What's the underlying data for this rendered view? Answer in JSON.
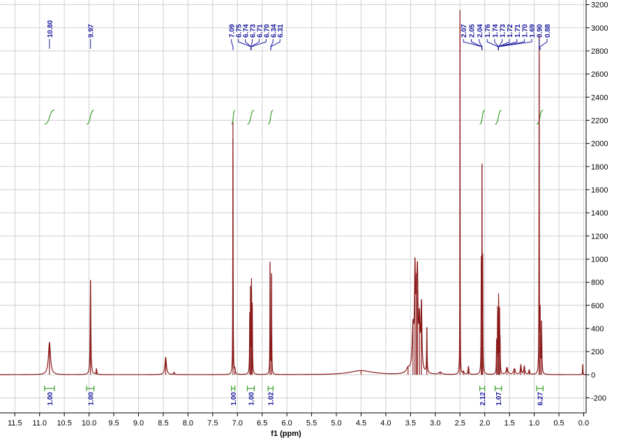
{
  "chart_data": {
    "type": "line",
    "xlabel": "f1 (ppm)",
    "ylabel": "",
    "xlim": [
      11.8,
      -0.05
    ],
    "ylim": [
      -330,
      3240
    ],
    "x_reversed": true,
    "grid": true,
    "x_ticks": [
      11.5,
      11.0,
      10.5,
      10.0,
      9.5,
      9.0,
      8.5,
      8.0,
      7.5,
      7.0,
      6.5,
      6.0,
      5.5,
      5.0,
      4.5,
      4.0,
      3.5,
      3.0,
      2.5,
      2.0,
      1.5,
      1.0,
      0.5,
      0.0
    ],
    "x_tick_labels": [
      "11.5",
      "11.0",
      "10.5",
      "10.0",
      "9.5",
      "9.0",
      "8.5",
      "8.0",
      "7.5",
      "7.0",
      "6.5",
      "6.0",
      "5.5",
      "5.0",
      "4.5",
      "4.0",
      "3.5",
      "3.0",
      "2.5",
      "2.0",
      "1.5",
      "1.0",
      "0.5",
      "0.0"
    ],
    "y_ticks": [
      3200,
      3000,
      2800,
      2600,
      2400,
      2200,
      2000,
      1800,
      1600,
      1400,
      1200,
      1000,
      800,
      600,
      400,
      200,
      0,
      -200
    ],
    "y_tick_labels": [
      "3200",
      "3000",
      "2800",
      "2600",
      "2400",
      "2200",
      "2000",
      "1800",
      "1600",
      "1400",
      "1200",
      "1000",
      "800",
      "600",
      "400",
      "200",
      "0",
      "-200"
    ],
    "colors": {
      "spectrum": "#8b1a1a",
      "peak_label": "#1a1aa0",
      "integral": "#3aa02a",
      "integral_label": "#1a1aa0",
      "grid": "#cfcfcf"
    },
    "peaks": [
      {
        "ppm": 10.8,
        "height": 280,
        "width": 0.025
      },
      {
        "ppm": 9.97,
        "height": 820,
        "width": 0.008
      },
      {
        "ppm": 9.85,
        "height": 50,
        "width": 0.008
      },
      {
        "ppm": 8.45,
        "height": 150,
        "width": 0.018
      },
      {
        "ppm": 8.28,
        "height": 20,
        "width": 0.01
      },
      {
        "ppm": 7.09,
        "height": 2180,
        "width": 0.004
      },
      {
        "ppm": 7.05,
        "height": 40,
        "width": 0.008
      },
      {
        "ppm": 6.75,
        "height": 480,
        "width": 0.005
      },
      {
        "ppm": 6.735,
        "height": 680,
        "width": 0.004
      },
      {
        "ppm": 6.715,
        "height": 740,
        "width": 0.004
      },
      {
        "ppm": 6.7,
        "height": 560,
        "width": 0.005
      },
      {
        "ppm": 6.34,
        "height": 960,
        "width": 0.004
      },
      {
        "ppm": 6.31,
        "height": 860,
        "width": 0.004
      },
      {
        "ppm": 4.5,
        "height": 35,
        "width": 0.28
      },
      {
        "ppm": 3.55,
        "height": 40,
        "width": 0.04
      },
      {
        "ppm": 3.45,
        "height": 360,
        "width": 0.02
      },
      {
        "ppm": 3.41,
        "height": 780,
        "width": 0.012
      },
      {
        "ppm": 3.38,
        "height": 520,
        "width": 0.015
      },
      {
        "ppm": 3.36,
        "height": 660,
        "width": 0.012
      },
      {
        "ppm": 3.32,
        "height": 420,
        "width": 0.015
      },
      {
        "ppm": 3.28,
        "height": 560,
        "width": 0.012
      },
      {
        "ppm": 3.17,
        "height": 390,
        "width": 0.006
      },
      {
        "ppm": 2.9,
        "height": 20,
        "width": 0.03
      },
      {
        "ppm": 2.5,
        "height": 3150,
        "width": 0.003
      },
      {
        "ppm": 2.43,
        "height": 25,
        "width": 0.012
      },
      {
        "ppm": 2.33,
        "height": 70,
        "width": 0.01
      },
      {
        "ppm": 2.07,
        "height": 920,
        "width": 0.004
      },
      {
        "ppm": 2.055,
        "height": 1700,
        "width": 0.0035
      },
      {
        "ppm": 2.04,
        "height": 940,
        "width": 0.004
      },
      {
        "ppm": 1.76,
        "height": 280,
        "width": 0.005
      },
      {
        "ppm": 1.74,
        "height": 540,
        "width": 0.004
      },
      {
        "ppm": 1.72,
        "height": 650,
        "width": 0.004
      },
      {
        "ppm": 1.7,
        "height": 500,
        "width": 0.004
      },
      {
        "ppm": 1.69,
        "height": 250,
        "width": 0.005
      },
      {
        "ppm": 1.55,
        "height": 60,
        "width": 0.02
      },
      {
        "ppm": 1.4,
        "height": 50,
        "width": 0.02
      },
      {
        "ppm": 1.27,
        "height": 80,
        "width": 0.012
      },
      {
        "ppm": 1.2,
        "height": 70,
        "width": 0.012
      },
      {
        "ppm": 1.1,
        "height": 40,
        "width": 0.012
      },
      {
        "ppm": 0.9,
        "height": 2900,
        "width": 0.0035
      },
      {
        "ppm": 0.88,
        "height": 500,
        "width": 0.005
      },
      {
        "ppm": 0.85,
        "height": 440,
        "width": 0.006
      },
      {
        "ppm": 0.02,
        "height": 90,
        "width": 0.004
      }
    ],
    "peak_label_groups": [
      {
        "labels": [
          "10.80"
        ],
        "positions": [
          10.8
        ],
        "target": 10.8
      },
      {
        "labels": [
          "9.97"
        ],
        "positions": [
          9.97
        ],
        "target": 9.97
      },
      {
        "labels": [
          "7.09",
          "6.75",
          "6.74",
          "6.73",
          "6.71",
          "6.70",
          "6.34",
          "6.31"
        ],
        "positions": [
          7.12,
          6.98,
          6.84,
          6.7,
          6.56,
          6.42,
          6.28,
          6.14
        ],
        "targets": [
          7.09,
          6.725,
          6.725,
          6.725,
          6.725,
          6.725,
          6.325,
          6.325
        ]
      },
      {
        "labels": [
          "2.07",
          "2.05",
          "2.04",
          "1.76",
          "1.74",
          "1.73",
          "1.72",
          "1.71",
          "1.70",
          "1.69",
          "0.90",
          "0.88"
        ],
        "positions": [
          2.43,
          2.27,
          2.11,
          1.95,
          1.8,
          1.65,
          1.5,
          1.35,
          1.2,
          1.05,
          0.9,
          0.74
        ],
        "targets": [
          2.055,
          2.055,
          2.055,
          1.725,
          1.725,
          1.725,
          1.725,
          1.725,
          1.725,
          1.725,
          0.9,
          0.88
        ]
      }
    ],
    "integrals": [
      {
        "label": "1.00",
        "from": 10.9,
        "to": 10.7,
        "center": 10.8
      },
      {
        "label": "1.00",
        "from": 10.05,
        "to": 9.9,
        "center": 9.97
      },
      {
        "label": "1.00",
        "from": 7.12,
        "to": 7.05,
        "center": 7.09
      },
      {
        "label": "1.00",
        "from": 6.8,
        "to": 6.66,
        "center": 6.73
      },
      {
        "label": "1.02",
        "from": 6.38,
        "to": 6.28,
        "center": 6.33
      },
      {
        "label": "2.12",
        "from": 2.1,
        "to": 2.0,
        "center": 2.05
      },
      {
        "label": "1.07",
        "from": 1.79,
        "to": 1.66,
        "center": 1.73
      },
      {
        "label": "6.27",
        "from": 0.95,
        "to": 0.82,
        "center": 0.89
      }
    ]
  }
}
